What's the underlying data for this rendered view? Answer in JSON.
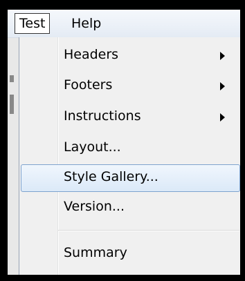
{
  "menubar": {
    "items": [
      {
        "label": "Test",
        "active": true
      },
      {
        "label": "Help",
        "active": false
      }
    ]
  },
  "menu": {
    "items": [
      {
        "label": "Headers",
        "submenu": true
      },
      {
        "label": "Footers",
        "submenu": true
      },
      {
        "label": "Instructions",
        "submenu": true
      },
      {
        "label": "Layout..."
      },
      {
        "label": "Style Gallery...",
        "highlighted": true
      },
      {
        "label": "Version..."
      },
      {
        "label": "Summary"
      }
    ]
  },
  "colors": {
    "highlight_border": "#7da2ce",
    "menu_background": "#f0f0f0"
  }
}
